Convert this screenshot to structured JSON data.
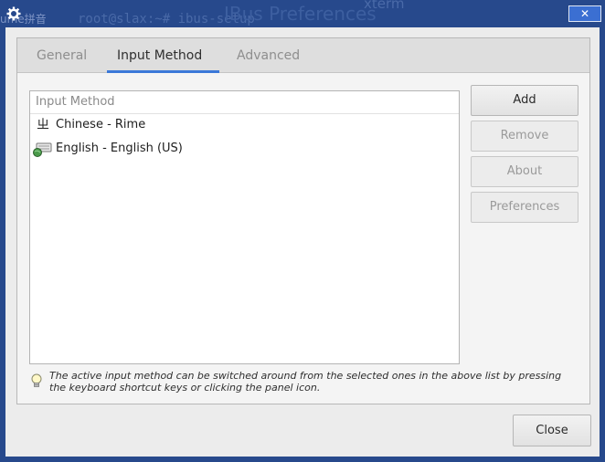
{
  "background": {
    "left_text": "ume拼音",
    "xterm_title": "xterm",
    "xterm_text": "root@slax:~# ibus-setup"
  },
  "window": {
    "title": "IBus Preferences",
    "close_label": "✕"
  },
  "tabs": [
    {
      "label": "General"
    },
    {
      "label": "Input Method"
    },
    {
      "label": "Advanced"
    }
  ],
  "input_method_list": {
    "header": "Input Method",
    "items": [
      {
        "icon": "chinese-rime-icon",
        "glyph": "ㄓ",
        "label": "Chinese - Rime"
      },
      {
        "icon": "keyboard-globe-icon",
        "label": "English - English (US)"
      }
    ]
  },
  "buttons": {
    "add": "Add",
    "remove": "Remove",
    "about": "About",
    "preferences": "Preferences",
    "close": "Close"
  },
  "info": {
    "text": "The active input method can be switched around from the selected ones in the above list by pressing the keyboard shortcut keys or clicking the panel icon."
  },
  "colors": {
    "accent": "#3b78d8",
    "titlebar": "#27498c",
    "close_button": "#3b6fd2"
  }
}
